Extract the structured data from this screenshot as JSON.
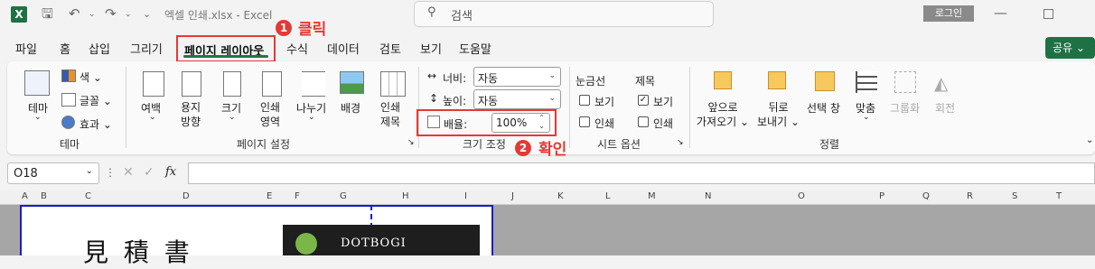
{
  "app": {
    "title": "엑셀 인쇄.xlsx  -  Excel",
    "search_placeholder": "검색",
    "login": "로그인"
  },
  "menu": {
    "items": [
      "파일",
      "홈",
      "삽입",
      "그리기",
      "수식",
      "데이터",
      "검토",
      "보기",
      "도움말"
    ],
    "active": "페이지 레이아웃",
    "share": "공유"
  },
  "annotations": {
    "step1_num": "1",
    "step1_text": "클릭",
    "step2_num": "2",
    "step2_text": "확인"
  },
  "ribbon": {
    "theme": {
      "theme": "테마",
      "colors": "색",
      "fonts": "글꼴",
      "effects": "효과",
      "group": "테마"
    },
    "page_setup": {
      "margins": "여백",
      "orientation_1": "용지",
      "orientation_2": "방향",
      "size": "크기",
      "print_area_1": "인쇄",
      "print_area_2": "영역",
      "breaks": "나누기",
      "background": "배경",
      "print_titles_1": "인쇄",
      "print_titles_2": "제목",
      "group": "페이지 설정"
    },
    "scale": {
      "width_label": "너비:",
      "width_value": "자동",
      "height_label": "높이:",
      "height_value": "자동",
      "scale_label": "배율:",
      "scale_value": "100%",
      "group": "크기 조정"
    },
    "sheet_options": {
      "gridlines": "눈금선",
      "headings": "제목",
      "view": "보기",
      "print": "인쇄",
      "group": "시트 옵션",
      "headings_view_checked": true
    },
    "arrange": {
      "bring_forward_1": "앞으로",
      "bring_forward_2": "가져오기",
      "send_backward_1": "뒤로",
      "send_backward_2": "보내기",
      "selection_pane": "선택 창",
      "align": "맞춤",
      "group_btn": "그룹화",
      "rotate": "회전",
      "group": "정렬"
    }
  },
  "formula": {
    "cell_ref": "O18",
    "fx": "fx",
    "value": ""
  },
  "columns": [
    "A",
    "B",
    "C",
    "D",
    "E",
    "F",
    "G",
    "H",
    "I",
    "J",
    "K",
    "L",
    "M",
    "N",
    "O",
    "P",
    "Q",
    "R",
    "S",
    "T"
  ],
  "sheet": {
    "doc_title": "見 積 書",
    "logo_text": "DOTBOGI"
  }
}
